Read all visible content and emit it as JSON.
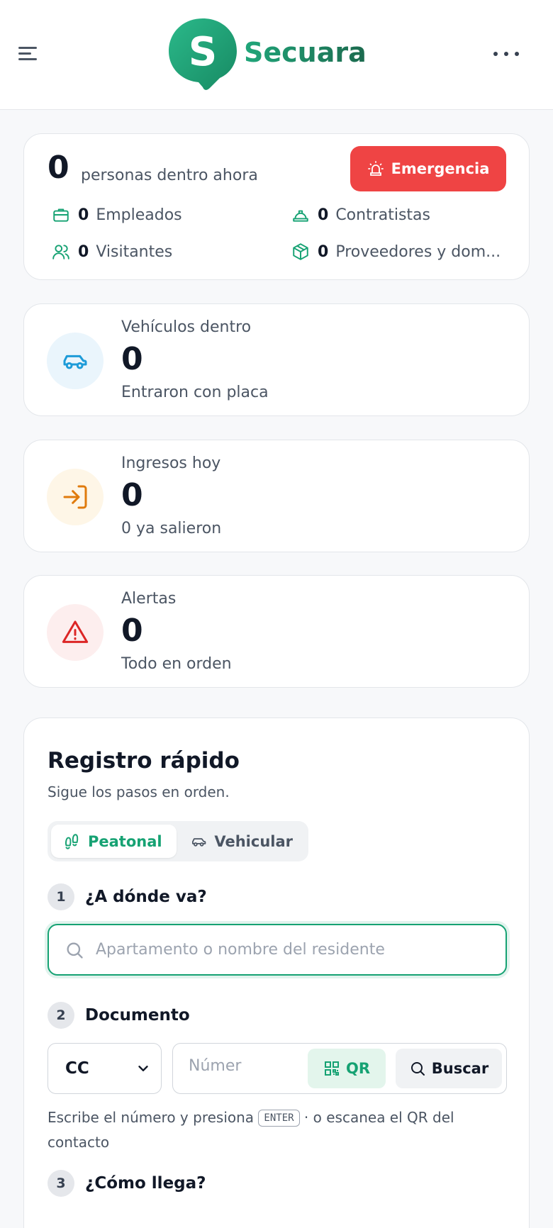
{
  "header": {
    "brand_letter": "S",
    "brand_name": "Secuara",
    "colors": {
      "brand_green": "#20a67a",
      "brand_dark_green": "#1c6a4e"
    }
  },
  "occupancy": {
    "count": "0",
    "label": "personas dentro ahora",
    "emergency_label": "Emergencia",
    "categories": [
      {
        "icon": "briefcase-icon",
        "count": "0",
        "label": "Empleados"
      },
      {
        "icon": "hard-hat-icon",
        "count": "0",
        "label": "Contratistas"
      },
      {
        "icon": "users-icon",
        "count": "0",
        "label": "Visitantes"
      },
      {
        "icon": "package-icon",
        "count": "0",
        "label": "Proveedores y dom..."
      }
    ]
  },
  "stats": {
    "vehicles": {
      "icon": "car-icon",
      "title": "Vehículos dentro",
      "value": "0",
      "subtitle": "Entraron con placa",
      "color": "#1d9bd8"
    },
    "entries": {
      "icon": "log-in-icon",
      "title": "Ingresos hoy",
      "value": "0",
      "subtitle": "0 ya salieron",
      "color": "#e07b0d"
    },
    "alerts": {
      "icon": "warning-icon",
      "title": "Alertas",
      "value": "0",
      "subtitle": "Todo en orden",
      "color": "#dc2626"
    }
  },
  "quick_register": {
    "title": "Registro rápido",
    "subtitle": "Sigue los pasos en orden.",
    "modes": {
      "pedestrian": "Peatonal",
      "vehicular": "Vehicular",
      "selected": "Peatonal"
    },
    "step1": {
      "number": "1",
      "label": "¿A dónde va?",
      "placeholder": "Apartamento o nombre del residente"
    },
    "step2": {
      "number": "2",
      "label": "Documento",
      "doc_type": "CC",
      "number_placeholder": "Númer",
      "qr_label": "QR",
      "search_label": "Buscar",
      "hint_before": "Escribe el número y presiona",
      "hint_key": "ENTER",
      "hint_after": "· o escanea el QR del contacto"
    },
    "step3": {
      "number": "3",
      "label": "¿Cómo llega?"
    }
  }
}
